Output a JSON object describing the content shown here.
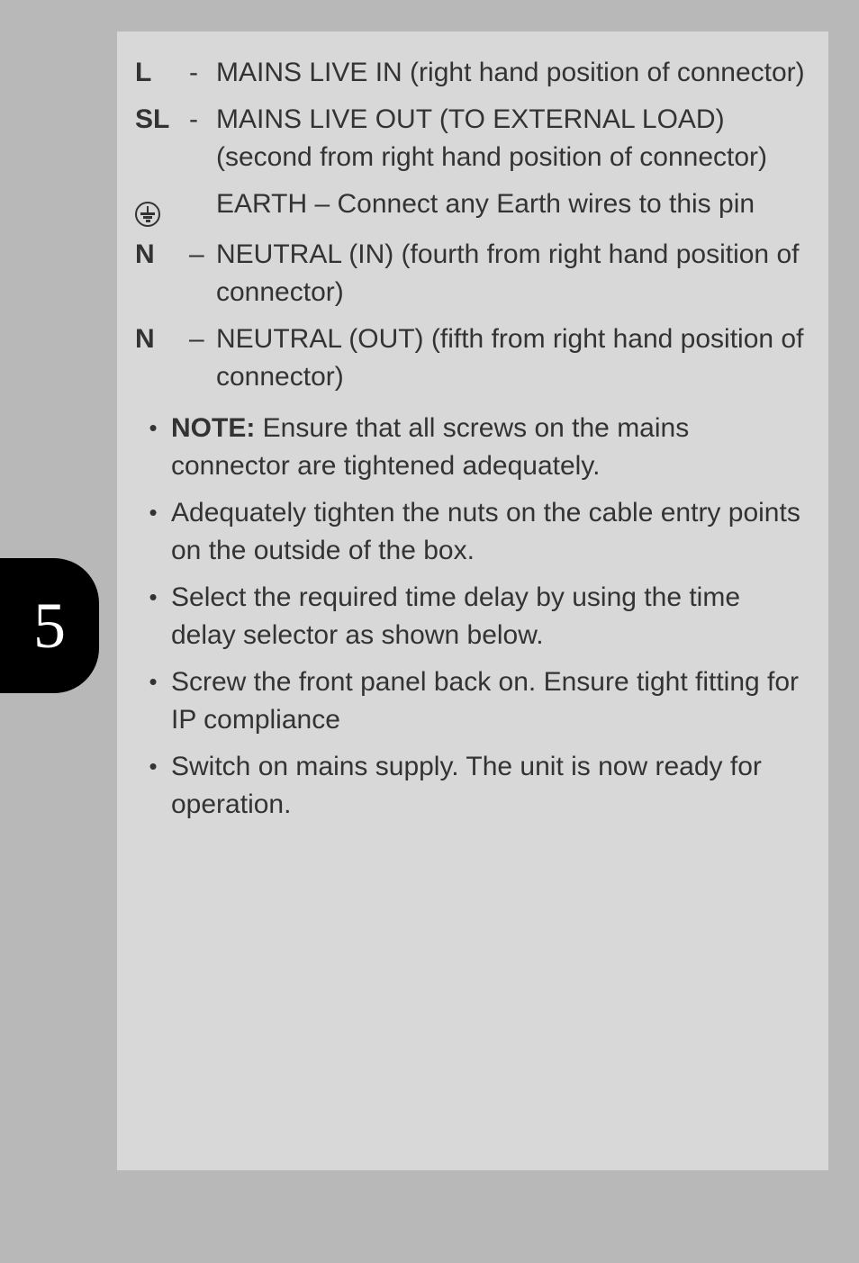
{
  "page_number": "5",
  "definitions": [
    {
      "label": "L",
      "sep": "-",
      "desc": "MAINS LIVE IN (right hand  position of connector)"
    },
    {
      "label": "SL",
      "sep": "-",
      "desc": "MAINS LIVE OUT (TO EXTERNAL LOAD) (second from right hand  position of connector)"
    },
    {
      "label": "EARTH_ICON",
      "sep": "",
      "desc": "EARTH – Connect any Earth wires to this pin"
    },
    {
      "label": "N",
      "sep": "–",
      "desc": "NEUTRAL (IN) (fourth from right hand  position of connector)"
    },
    {
      "label": "N",
      "sep": "–",
      "desc": "NEUTRAL (OUT) (fifth from right hand  position of connector)"
    }
  ],
  "bullets": [
    {
      "bold_prefix": "NOTE:",
      "text": " Ensure that all screws on the mains connector are tightened adequately."
    },
    {
      "bold_prefix": "",
      "text": "Adequately tighten the nuts on the cable entry points on the outside of the box."
    },
    {
      "bold_prefix": "",
      "text": "Select the required time delay by using the time delay selector as shown below."
    },
    {
      "bold_prefix": "",
      "text": "Screw the front panel back on. Ensure tight fitting for IP compliance"
    },
    {
      "bold_prefix": "",
      "text": "Switch on mains supply. The unit is now ready for operation."
    }
  ]
}
